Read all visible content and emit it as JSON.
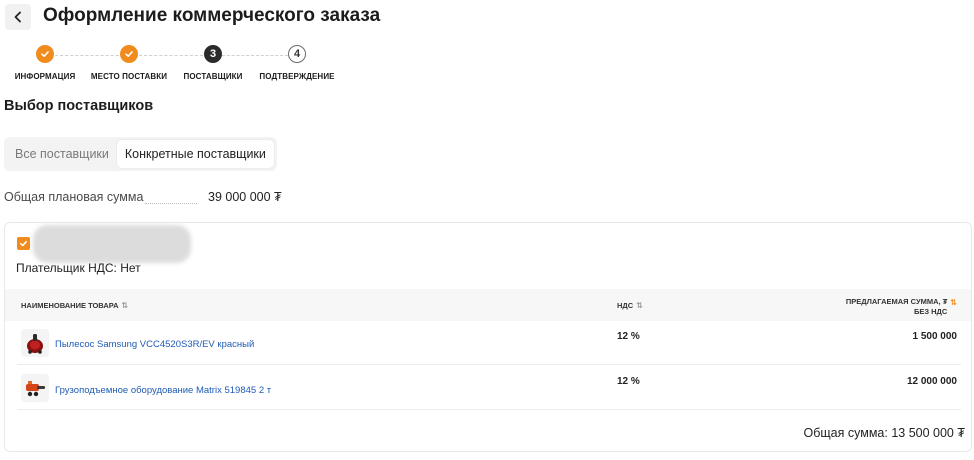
{
  "header": {
    "title": "Оформление коммерческого заказа",
    "back_icon": "chevron-left-icon"
  },
  "steps": [
    {
      "number": "1",
      "label": "ИНФОРМАЦИЯ",
      "state": "done"
    },
    {
      "number": "2",
      "label": "МЕСТО ПОСТАВКИ",
      "state": "done"
    },
    {
      "number": "3",
      "label": "ПОСТАВЩИКИ",
      "state": "current"
    },
    {
      "number": "4",
      "label": "ПОДТВЕРЖДЕНИЕ",
      "state": "todo"
    }
  ],
  "section_title": "Выбор поставщиков",
  "segmented": {
    "all_label": "Все поставщики",
    "specific_label": "Конкретные поставщики",
    "active": "specific"
  },
  "plan": {
    "label": "Общая плановая сумма",
    "value": "39 000 000 ₮"
  },
  "supplier": {
    "checked": true,
    "payer_vat": "Плательщик НДС: Нет"
  },
  "table": {
    "col_name": "НАИМЕНОВАНИЕ ТОВАРА",
    "col_vat": "НДС",
    "col_amount_line1": "ПРЕДЛАГАЕМАЯ СУММА, ₮",
    "col_amount_line2": "БЕЗ НДС",
    "rows": [
      {
        "name": "Пылесос Samsung VCC4520S3R/EV красный",
        "vat": "12 %",
        "amount": "1 500 000"
      },
      {
        "name": "Грузоподъемное оборудование Matrix 519845 2 т",
        "vat": "12 %",
        "amount": "12 000 000"
      }
    ]
  },
  "total": "Общая сумма: 13 500 000 ₮",
  "colors": {
    "accent": "#f08c1e",
    "link": "#1f5bb5",
    "current_step": "#2b2b2b"
  }
}
